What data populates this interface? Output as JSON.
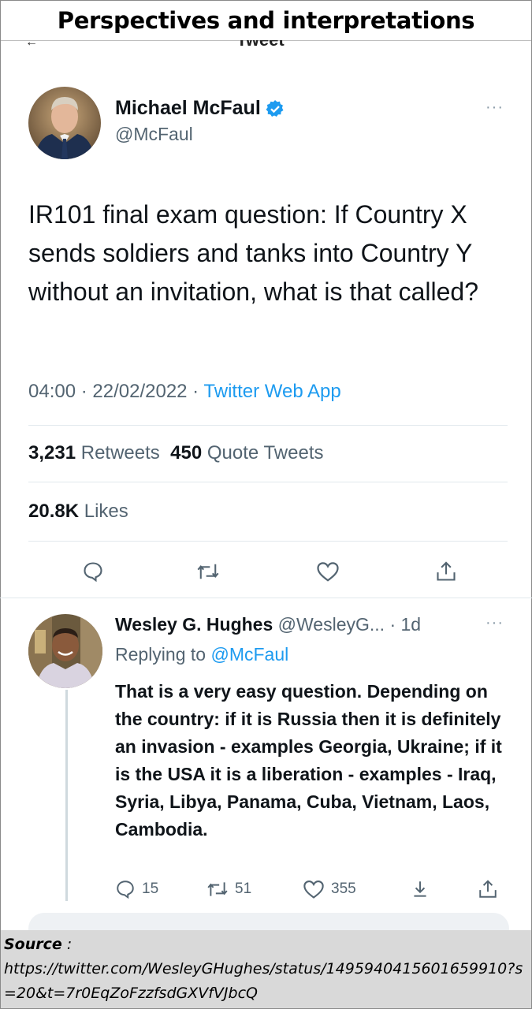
{
  "banner": {
    "title": "Perspectives and interpretations"
  },
  "tweet": {
    "author_name": "Michael McFaul",
    "author_handle": "@McFaul",
    "more": "···",
    "text": "IR101 final exam question: If Country X sends soldiers and tanks into Country Y without an invitation, what is that called?",
    "time": "04:00",
    "date": "22/02/2022",
    "app": "Twitter Web App",
    "retweets_count": "3,231",
    "retweets_label": "Retweets",
    "quotes_count": "450",
    "quotes_label": "Quote Tweets",
    "likes_count": "20.8K",
    "likes_label": "Likes",
    "actions": [
      "reply-icon",
      "retweet-icon",
      "like-icon",
      "share-icon"
    ]
  },
  "reply": {
    "author_name": "Wesley G. Hughes",
    "author_handle": "@WesleyG...",
    "age": "· 1d",
    "more": "···",
    "replying_prefix": "Replying to",
    "replying_to": "@McFaul",
    "text": "That is a very easy question. Depending on the country: if it is Russia then it is definitely an invasion - examples Georgia, Ukraine; if it is the USA it is a liberation - examples - Iraq, Syria, Libya, Panama, Cuba, Vietnam, Laos, Cambodia.",
    "reply_count": "15",
    "retweet_count": "51",
    "like_count": "355"
  },
  "source": {
    "label": "Source",
    "colon": " :",
    "url": "https://twitter.com/WesleyGHughes/status/1495940415601659910?s=20&t=7r0EqZoFzzfsdGXVfVJbcQ"
  },
  "colors": {
    "accent": "#1d9bf0",
    "muted": "#536471",
    "text": "#0f1419",
    "source_bg": "#d9d9d9"
  }
}
